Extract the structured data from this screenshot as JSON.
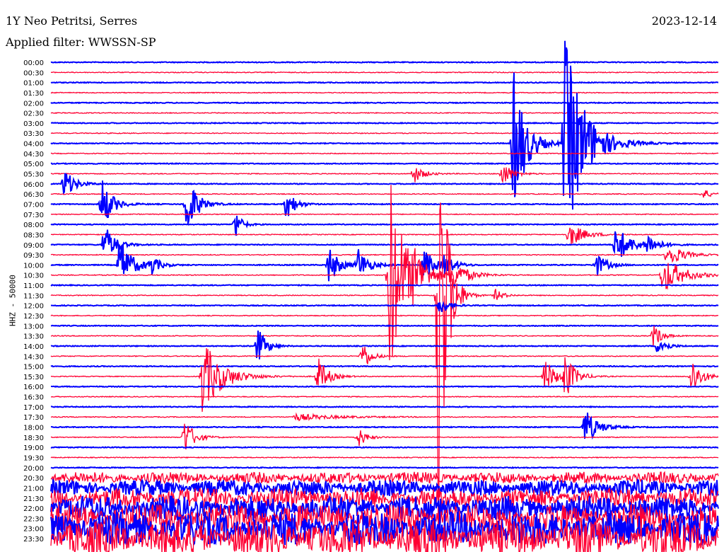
{
  "header": {
    "station": "1Y Neo Petritsi, Serres",
    "filter": "Applied filter: WWSSN-SP",
    "date": "2023-12-14"
  },
  "chart_data": {
    "type": "line",
    "title": "1Y Neo Petritsi, Serres",
    "ylabel": "HHZ - 50000",
    "minutes_per_line": 30,
    "colors": [
      "#0000ff",
      "#ff0033"
    ],
    "row_labels": [
      "00:00",
      "00:30",
      "01:00",
      "01:30",
      "02:00",
      "02:30",
      "03:00",
      "03:30",
      "04:00",
      "04:30",
      "05:00",
      "05:30",
      "06:00",
      "06:30",
      "07:00",
      "07:30",
      "08:00",
      "08:30",
      "09:00",
      "09:30",
      "10:00",
      "10:30",
      "11:00",
      "11:30",
      "12:00",
      "12:30",
      "13:00",
      "13:30",
      "14:00",
      "14:30",
      "15:00",
      "15:30",
      "16:00",
      "16:30",
      "17:00",
      "17:30",
      "18:00",
      "18:30",
      "19:00",
      "19:30",
      "20:00",
      "20:30",
      "21:00",
      "21:30",
      "22:00",
      "22:30",
      "23:00",
      "23:30"
    ],
    "events": [
      {
        "row": "04:00",
        "minute": 20.8,
        "amplitude": 110,
        "duration": 1.2
      },
      {
        "row": "04:00",
        "minute": 23.1,
        "amplitude": 150,
        "duration": 2.0
      },
      {
        "row": "05:30",
        "minute": 16.3,
        "amplitude": 14,
        "duration": 1.0
      },
      {
        "row": "05:30",
        "minute": 20.3,
        "amplitude": 18,
        "duration": 1.0
      },
      {
        "row": "10:30",
        "minute": 15.2,
        "amplitude": 160,
        "duration": 1.5
      },
      {
        "row": "11:30",
        "minute": 17.4,
        "amplitude": 420,
        "duration": 0.8
      },
      {
        "row": "06:00",
        "minute": 0.6,
        "amplitude": 22,
        "duration": 1.0
      },
      {
        "row": "07:00",
        "minute": 2.3,
        "amplitude": 38,
        "duration": 1.0
      },
      {
        "row": "07:00",
        "minute": 6.1,
        "amplitude": 48,
        "duration": 1.0
      },
      {
        "row": "08:00",
        "minute": 8.3,
        "amplitude": 22,
        "duration": 0.6
      },
      {
        "row": "07:00",
        "minute": 10.6,
        "amplitude": 25,
        "duration": 0.8
      },
      {
        "row": "06:30",
        "minute": 29.3,
        "amplitude": 8,
        "duration": 0.8
      },
      {
        "row": "09:00",
        "minute": 2.4,
        "amplitude": 30,
        "duration": 1.0
      },
      {
        "row": "09:00",
        "minute": 25.4,
        "amplitude": 28,
        "duration": 1.5
      },
      {
        "row": "09:00",
        "minute": 26.8,
        "amplitude": 14,
        "duration": 1.0
      },
      {
        "row": "10:00",
        "minute": 3.1,
        "amplitude": 40,
        "duration": 1.2
      },
      {
        "row": "10:00",
        "minute": 4.5,
        "amplitude": 14,
        "duration": 0.8
      },
      {
        "row": "10:00",
        "minute": 12.5,
        "amplitude": 28,
        "duration": 1.0
      },
      {
        "row": "10:00",
        "minute": 13.8,
        "amplitude": 24,
        "duration": 1.0
      },
      {
        "row": "10:00",
        "minute": 16.8,
        "amplitude": 24,
        "duration": 1.0
      },
      {
        "row": "10:00",
        "minute": 17.7,
        "amplitude": 14,
        "duration": 1.0
      },
      {
        "row": "10:00",
        "minute": 24.5,
        "amplitude": 18,
        "duration": 1.0
      },
      {
        "row": "10:30",
        "minute": 16.3,
        "amplitude": 22,
        "duration": 1.5
      },
      {
        "row": "10:30",
        "minute": 18.0,
        "amplitude": 24,
        "duration": 1.5
      },
      {
        "row": "10:30",
        "minute": 27.5,
        "amplitude": 28,
        "duration": 2.0
      },
      {
        "row": "08:30",
        "minute": 23.3,
        "amplitude": 18,
        "duration": 1.5
      },
      {
        "row": "09:30",
        "minute": 27.7,
        "amplitude": 18,
        "duration": 1.5
      },
      {
        "row": "11:30",
        "minute": 20.0,
        "amplitude": 9,
        "duration": 0.8
      },
      {
        "row": "12:00",
        "minute": 17.5,
        "amplitude": 14,
        "duration": 0.8
      },
      {
        "row": "13:30",
        "minute": 27.1,
        "amplitude": 18,
        "duration": 0.8
      },
      {
        "row": "14:00",
        "minute": 9.3,
        "amplitude": 28,
        "duration": 0.8
      },
      {
        "row": "14:00",
        "minute": 27.3,
        "amplitude": 14,
        "duration": 0.8
      },
      {
        "row": "14:30",
        "minute": 14.0,
        "amplitude": 24,
        "duration": 0.8
      },
      {
        "row": "15:30",
        "minute": 6.8,
        "amplitude": 55,
        "duration": 2.0
      },
      {
        "row": "15:30",
        "minute": 12.0,
        "amplitude": 28,
        "duration": 1.0
      },
      {
        "row": "15:30",
        "minute": 22.2,
        "amplitude": 28,
        "duration": 1.0
      },
      {
        "row": "15:30",
        "minute": 23.1,
        "amplitude": 34,
        "duration": 1.0
      },
      {
        "row": "15:30",
        "minute": 28.8,
        "amplitude": 28,
        "duration": 1.0
      },
      {
        "row": "17:30",
        "minute": 11.0,
        "amplitude": 5,
        "duration": 4.0
      },
      {
        "row": "18:00",
        "minute": 24.0,
        "amplitude": 28,
        "duration": 1.2
      },
      {
        "row": "18:30",
        "minute": 6.0,
        "amplitude": 28,
        "duration": 1.0
      },
      {
        "row": "18:30",
        "minute": 13.8,
        "amplitude": 16,
        "duration": 0.8
      }
    ],
    "noise_from_row": "20:30"
  }
}
